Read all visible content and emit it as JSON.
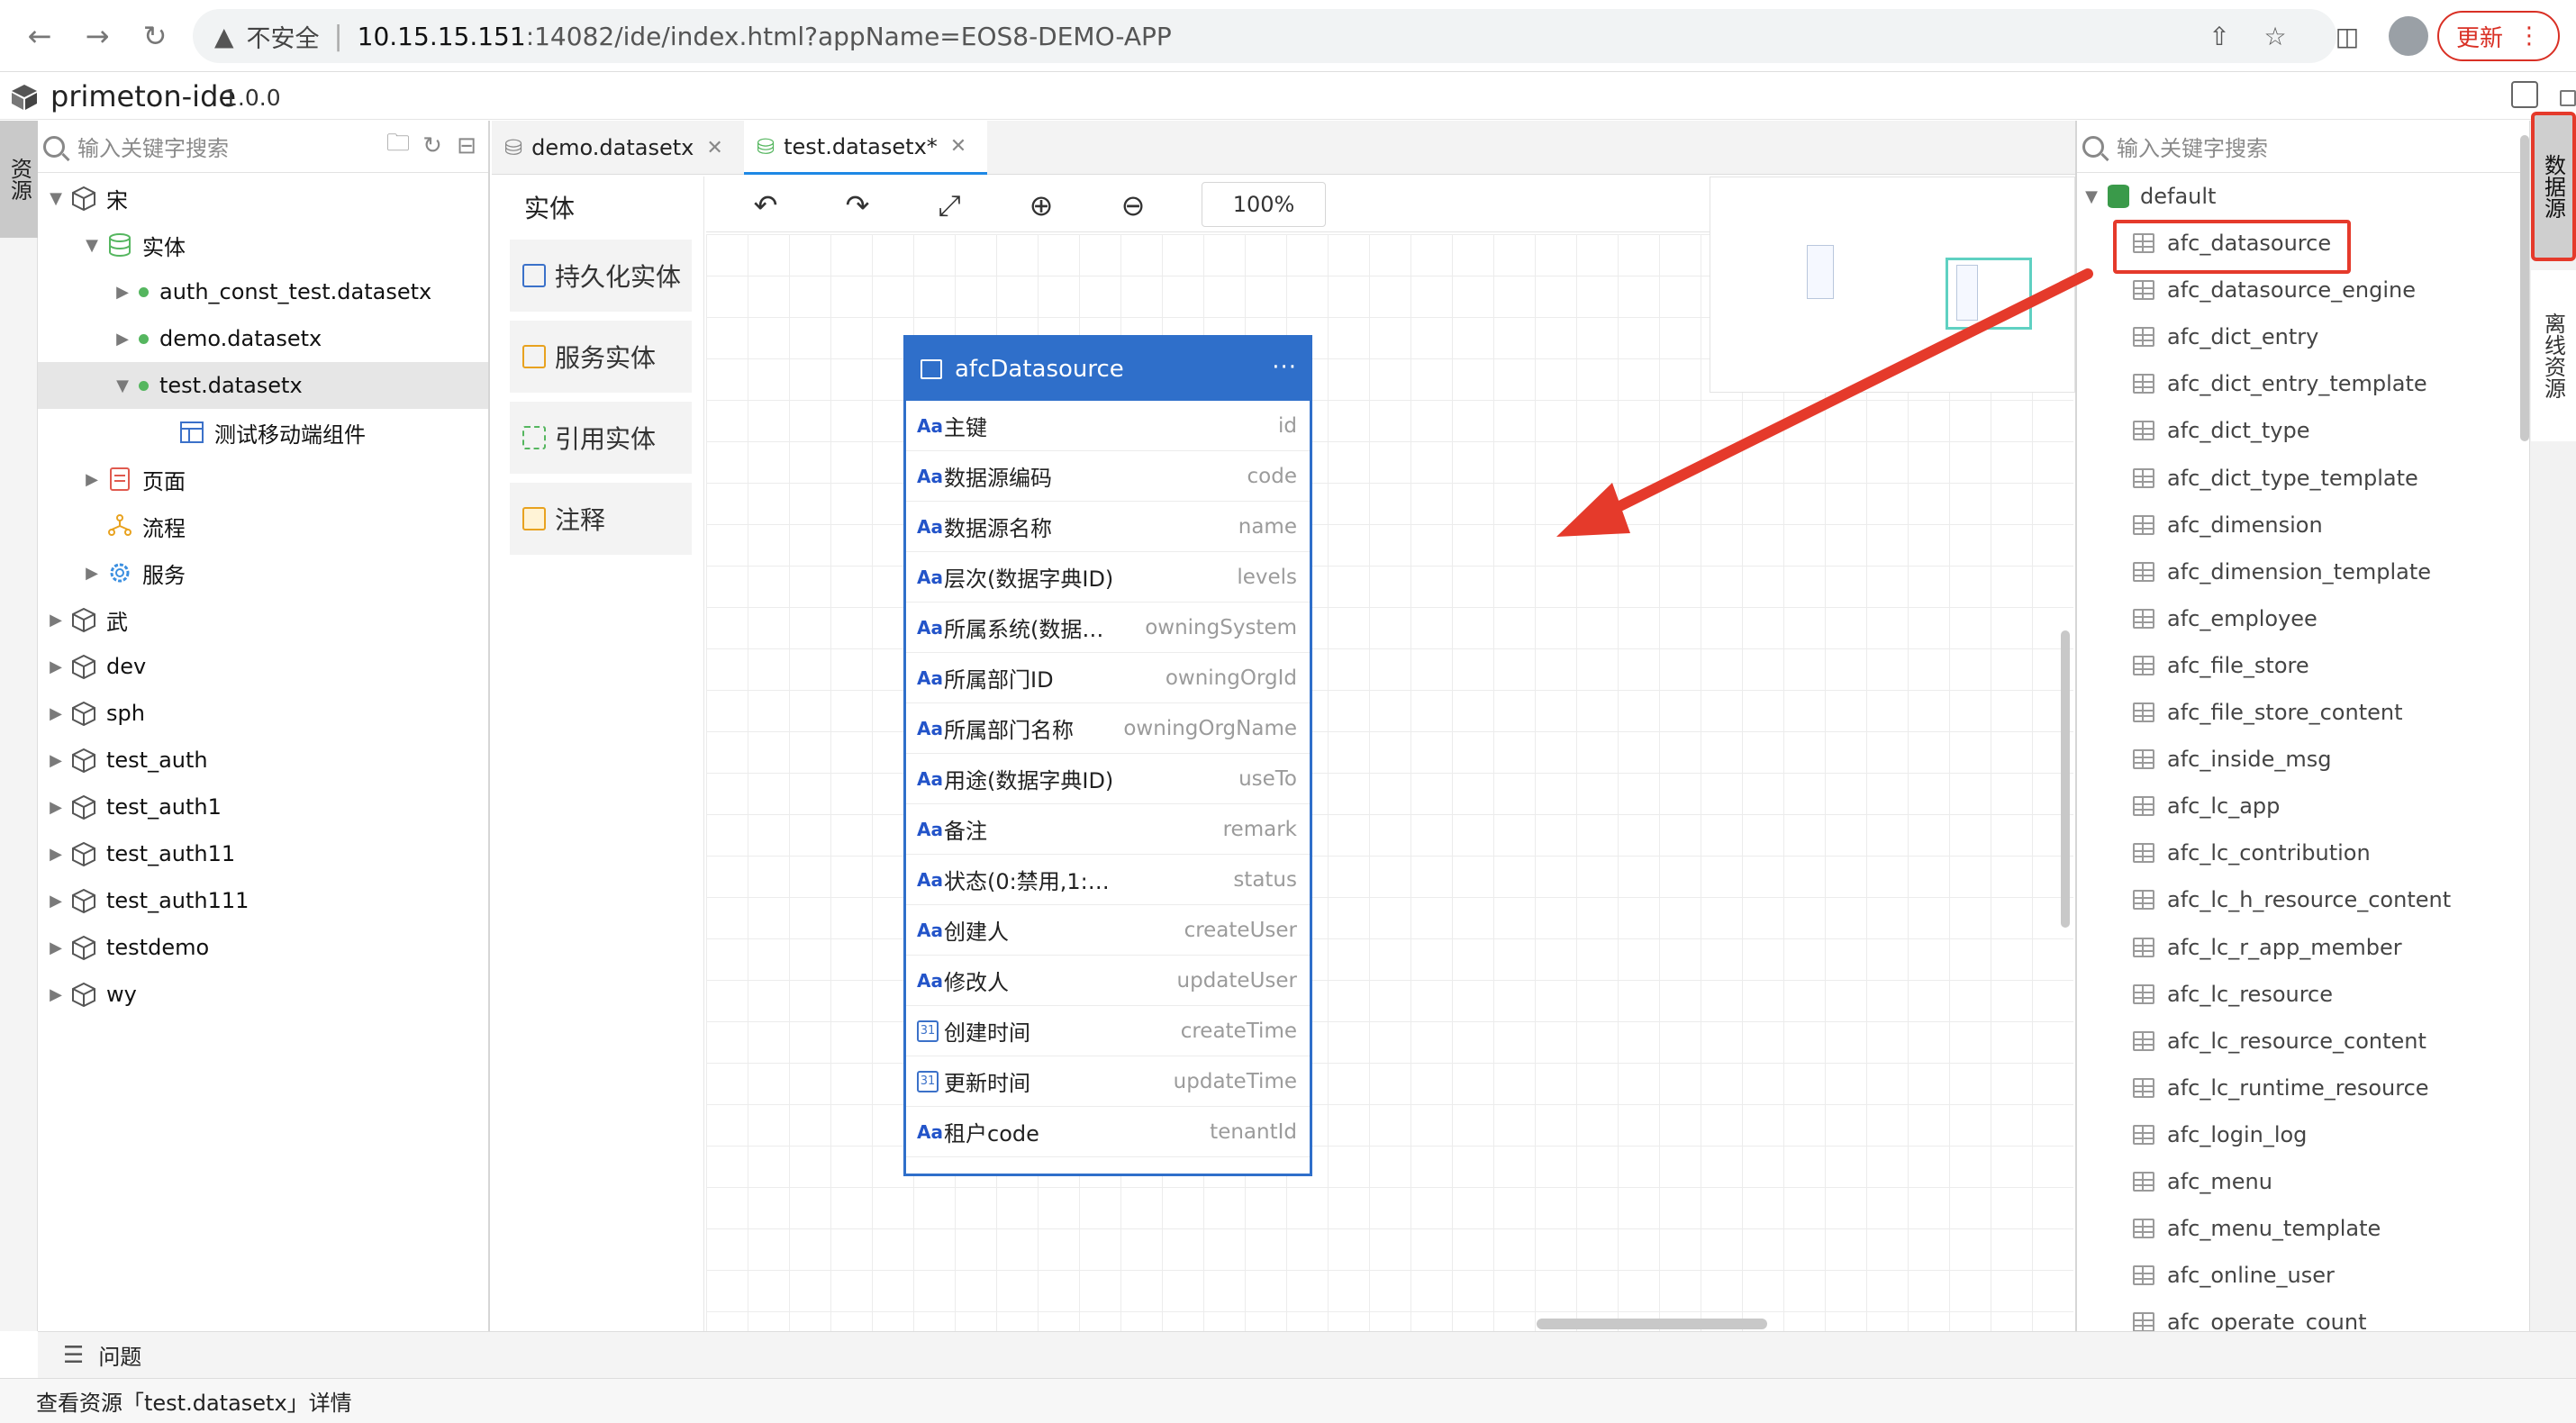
{
  "browser": {
    "back_icon": "arrow-left-icon",
    "forward_icon": "arrow-right-icon",
    "reload_icon": "reload-icon",
    "security_label": "不安全",
    "url_host": "10.15.15.151",
    "url_rest": ":14082/ide/index.html?appName=EOS8-DEMO-APP",
    "update_label": "更新"
  },
  "app": {
    "name": "primeton-ide",
    "version": "1.0.0"
  },
  "left_vtab": "资源",
  "left": {
    "search_placeholder": "输入关键字搜索",
    "tree": [
      {
        "label": "宋",
        "expanded": true
      },
      {
        "label": "实体",
        "expanded": true
      },
      {
        "label": "auth_const_test.datasetx"
      },
      {
        "label": "demo.datasetx"
      },
      {
        "label": "test.datasetx",
        "selected": true
      },
      {
        "label": "测试移动端组件"
      },
      {
        "label": "页面"
      },
      {
        "label": "流程"
      },
      {
        "label": "服务"
      },
      {
        "label": "武"
      },
      {
        "label": "dev"
      },
      {
        "label": "sph"
      },
      {
        "label": "test_auth"
      },
      {
        "label": "test_auth1"
      },
      {
        "label": "test_auth11"
      },
      {
        "label": "test_auth111"
      },
      {
        "label": "testdemo"
      },
      {
        "label": "wy"
      }
    ]
  },
  "tabs": [
    {
      "label": "demo.datasetx"
    },
    {
      "label": "test.datasetx*",
      "active": true
    }
  ],
  "palette": {
    "title": "实体",
    "items": [
      "持久化实体",
      "服务实体",
      "引用实体",
      "注释"
    ]
  },
  "toolbar": {
    "zoom": "100%"
  },
  "entity": {
    "title": "afcDatasource",
    "more": "···",
    "fields": [
      {
        "label": "主键",
        "name": "id",
        "type": "key"
      },
      {
        "label": "数据源编码",
        "name": "code",
        "type": "text"
      },
      {
        "label": "数据源名称",
        "name": "name",
        "type": "text"
      },
      {
        "label": "层次(数据字典ID)",
        "name": "levels",
        "type": "text"
      },
      {
        "label": "所属系统(数据…",
        "name": "owningSystem",
        "type": "text"
      },
      {
        "label": "所属部门ID",
        "name": "owningOrgId",
        "type": "text"
      },
      {
        "label": "所属部门名称",
        "name": "owningOrgName",
        "type": "text"
      },
      {
        "label": "用途(数据字典ID)",
        "name": "useTo",
        "type": "text"
      },
      {
        "label": "备注",
        "name": "remark",
        "type": "text"
      },
      {
        "label": "状态(0:禁用,1:…",
        "name": "status",
        "type": "text"
      },
      {
        "label": "创建人",
        "name": "createUser",
        "type": "text"
      },
      {
        "label": "修改人",
        "name": "updateUser",
        "type": "text"
      },
      {
        "label": "创建时间",
        "name": "createTime",
        "type": "date"
      },
      {
        "label": "更新时间",
        "name": "updateTime",
        "type": "date"
      },
      {
        "label": "租户code",
        "name": "tenantId",
        "type": "text"
      }
    ],
    "type_badges": {
      "text": "Aa",
      "date": "31",
      "key": "Aa"
    }
  },
  "right": {
    "search_placeholder": "输入关键字搜索",
    "root": "default",
    "tables": [
      "afc_datasource",
      "afc_datasource_engine",
      "afc_dict_entry",
      "afc_dict_entry_template",
      "afc_dict_type",
      "afc_dict_type_template",
      "afc_dimension",
      "afc_dimension_template",
      "afc_employee",
      "afc_file_store",
      "afc_file_store_content",
      "afc_inside_msg",
      "afc_lc_app",
      "afc_lc_contribution",
      "afc_lc_h_resource_content",
      "afc_lc_r_app_member",
      "afc_lc_resource",
      "afc_lc_resource_content",
      "afc_lc_runtime_resource",
      "afc_login_log",
      "afc_menu",
      "afc_menu_template",
      "afc_online_user",
      "afc_operate_count"
    ]
  },
  "right_vtabs": [
    "数据源",
    "离线资源"
  ],
  "bottom": {
    "problems": "问题",
    "status": "查看资源「test.datasetx」详情"
  },
  "colors": {
    "accent": "#2f6fca",
    "annotation": "#e53a2b",
    "status_green": "#55b65f"
  }
}
